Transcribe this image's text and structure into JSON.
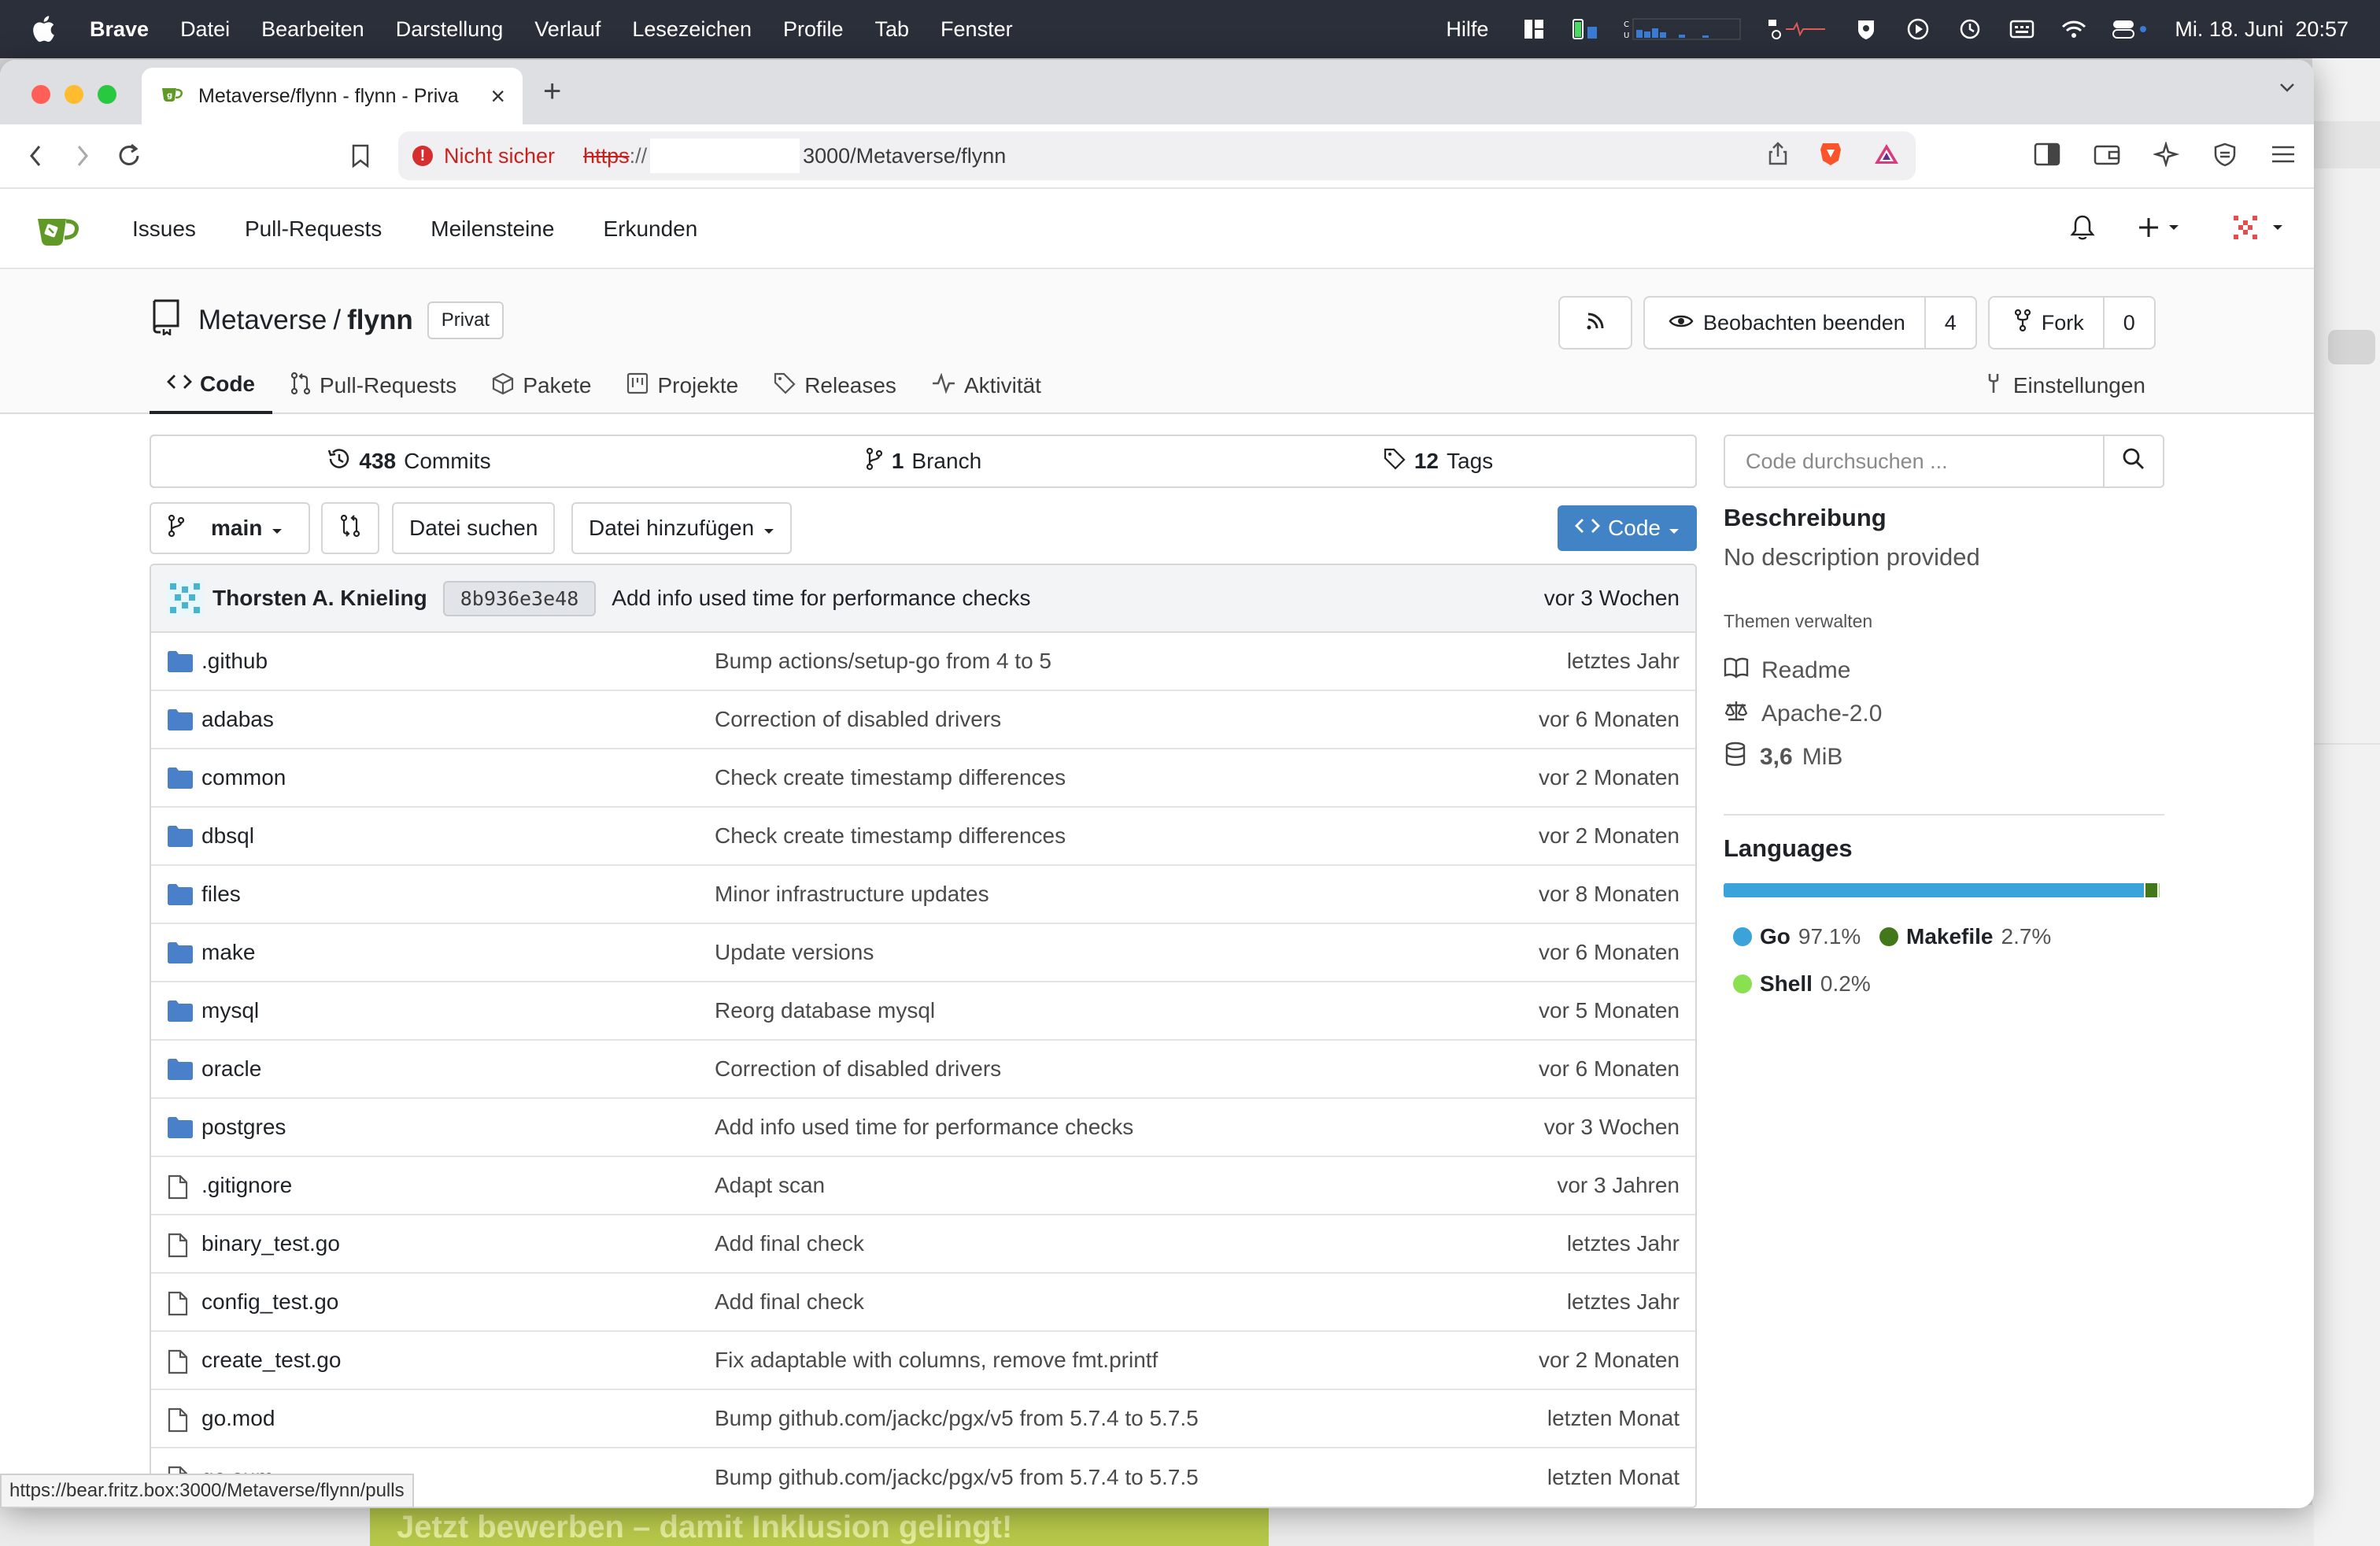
{
  "menubar": {
    "app": "Brave",
    "items": [
      "Datei",
      "Bearbeiten",
      "Darstellung",
      "Verlauf",
      "Lesezeichen",
      "Profile",
      "Tab",
      "Fenster"
    ],
    "help": "Hilfe",
    "clock": "Mi. 18. Juni  20:57"
  },
  "browser": {
    "tab_title": "Metaverse/flynn - flynn - Priva",
    "url_warning": "Nicht sicher",
    "url_scheme": "https",
    "url_slashes": "://",
    "url_path": "3000/Metaverse/flynn",
    "status_url": "https://bear.fritz.box:3000/Metaverse/flynn/pulls"
  },
  "header": {
    "nav": [
      "Issues",
      "Pull-Requests",
      "Meilensteine",
      "Erkunden"
    ]
  },
  "repo": {
    "owner": "Metaverse",
    "separator": "/",
    "name": "flynn",
    "visibility": "Privat",
    "watch_label": "Beobachten beenden",
    "watch_count": "4",
    "fork_label": "Fork",
    "fork_count": "0",
    "tabs": {
      "code": "Code",
      "pulls": "Pull-Requests",
      "packages": "Pakete",
      "projects": "Projekte",
      "releases": "Releases",
      "activity": "Aktivität"
    },
    "settings": "Einstellungen"
  },
  "stats": {
    "commits_num": "438",
    "commits_label": "Commits",
    "branch_num": "1",
    "branch_label": "Branch",
    "tags_num": "12",
    "tags_label": "Tags"
  },
  "toolbar": {
    "branch": "main",
    "find_file": "Datei suchen",
    "add_file": "Datei hinzufügen",
    "code": "Code"
  },
  "latest_commit": {
    "author": "Thorsten A. Knieling",
    "sha": "8b936e3e48",
    "message": "Add info used time for performance checks",
    "time": "vor 3 Wochen"
  },
  "files": [
    {
      "type": "dir",
      "name": ".github",
      "message": "Bump actions/setup-go from 4 to 5",
      "time": "letztes Jahr"
    },
    {
      "type": "dir",
      "name": "adabas",
      "message": "Correction of disabled drivers",
      "time": "vor 6 Monaten"
    },
    {
      "type": "dir",
      "name": "common",
      "message": "Check create timestamp differences",
      "time": "vor 2 Monaten"
    },
    {
      "type": "dir",
      "name": "dbsql",
      "message": "Check create timestamp differences",
      "time": "vor 2 Monaten"
    },
    {
      "type": "dir",
      "name": "files",
      "message": "Minor infrastructure updates",
      "time": "vor 8 Monaten"
    },
    {
      "type": "dir",
      "name": "make",
      "message": "Update versions",
      "time": "vor 6 Monaten"
    },
    {
      "type": "dir",
      "name": "mysql",
      "message": "Reorg database mysql",
      "time": "vor 5 Monaten"
    },
    {
      "type": "dir",
      "name": "oracle",
      "message": "Correction of disabled drivers",
      "time": "vor 6 Monaten"
    },
    {
      "type": "dir",
      "name": "postgres",
      "message": "Add info used time for performance checks",
      "time": "vor 3 Wochen"
    },
    {
      "type": "file",
      "name": ".gitignore",
      "message": "Adapt scan",
      "time": "vor 3 Jahren"
    },
    {
      "type": "file",
      "name": "binary_test.go",
      "message": "Add final check",
      "time": "letztes Jahr"
    },
    {
      "type": "file",
      "name": "config_test.go",
      "message": "Add final check",
      "time": "letztes Jahr"
    },
    {
      "type": "file",
      "name": "create_test.go",
      "message": "Fix adaptable with columns, remove fmt.printf",
      "time": "vor 2 Monaten"
    },
    {
      "type": "file",
      "name": "go.mod",
      "message": "Bump github.com/jackc/pgx/v5 from 5.7.4 to 5.7.5",
      "time": "letzten Monat"
    },
    {
      "type": "file",
      "name": "go.sum",
      "message": "Bump github.com/jackc/pgx/v5 from 5.7.4 to 5.7.5",
      "time": "letzten Monat"
    }
  ],
  "sidebar": {
    "search_placeholder": "Code durchsuchen ...",
    "description_title": "Beschreibung",
    "description": "No description provided",
    "topics": "Themen verwalten",
    "readme": "Readme",
    "license": "Apache-2.0",
    "size_value": "3,6",
    "size_unit": "MiB",
    "languages_title": "Languages",
    "languages": [
      {
        "name": "Go",
        "percent": "97.1%",
        "share": 97.1,
        "color": "#3aa3d9"
      },
      {
        "name": "Makefile",
        "percent": "2.7%",
        "share": 2.7,
        "color": "#427819"
      },
      {
        "name": "Shell",
        "percent": "0.2%",
        "share": 0.2,
        "color": "#89e051"
      }
    ]
  },
  "background": {
    "banner_text": "Jetzt bewerben – damit Inklusion gelingt!"
  },
  "colors": {
    "accent": "#4183c4",
    "folder": "#4a7fc9",
    "warning": "#c8221f"
  }
}
